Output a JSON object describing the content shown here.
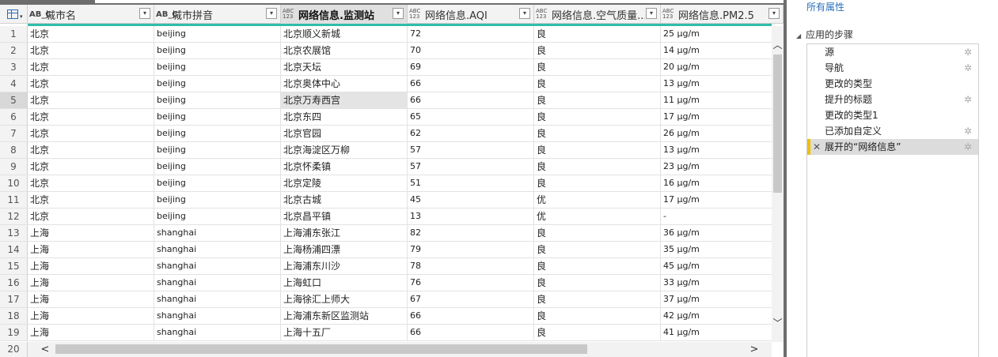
{
  "columns": [
    {
      "type": "AB_C",
      "name": "城市名"
    },
    {
      "type": "AB_C",
      "name": "城市拼音"
    },
    {
      "type_top": "ABC",
      "type_bottom": "123",
      "name": "网络信息.监测站"
    },
    {
      "type_top": "ABC",
      "type_bottom": "123",
      "name": "网络信息.AQI"
    },
    {
      "type_top": "ABC",
      "type_bottom": "123",
      "name": "网络信息.空气质量..."
    },
    {
      "type_top": "ABC",
      "type_bottom": "123",
      "name": "网络信息.PM2.5"
    }
  ],
  "rows": [
    {
      "n": "1",
      "c": [
        "北京",
        "beijing",
        "北京顺义新城",
        "72",
        "良",
        "25 μg/m"
      ]
    },
    {
      "n": "2",
      "c": [
        "北京",
        "beijing",
        "北京农展馆",
        "70",
        "良",
        "14 μg/m"
      ]
    },
    {
      "n": "3",
      "c": [
        "北京",
        "beijing",
        "北京天坛",
        "69",
        "良",
        "20 μg/m"
      ]
    },
    {
      "n": "4",
      "c": [
        "北京",
        "beijing",
        "北京奥体中心",
        "66",
        "良",
        "13 μg/m"
      ]
    },
    {
      "n": "5",
      "c": [
        "北京",
        "beijing",
        "北京万寿西宫",
        "66",
        "良",
        "11 μg/m"
      ]
    },
    {
      "n": "6",
      "c": [
        "北京",
        "beijing",
        "北京东四",
        "65",
        "良",
        "17 μg/m"
      ]
    },
    {
      "n": "7",
      "c": [
        "北京",
        "beijing",
        "北京官园",
        "62",
        "良",
        "26 μg/m"
      ]
    },
    {
      "n": "8",
      "c": [
        "北京",
        "beijing",
        "北京海淀区万柳",
        "57",
        "良",
        "13 μg/m"
      ]
    },
    {
      "n": "9",
      "c": [
        "北京",
        "beijing",
        "北京怀柔镇",
        "57",
        "良",
        "23 μg/m"
      ]
    },
    {
      "n": "10",
      "c": [
        "北京",
        "beijing",
        "北京定陵",
        "51",
        "良",
        "16 μg/m"
      ]
    },
    {
      "n": "11",
      "c": [
        "北京",
        "beijing",
        "北京古城",
        "45",
        "优",
        "17 μg/m"
      ]
    },
    {
      "n": "12",
      "c": [
        "北京",
        "beijing",
        "北京昌平镇",
        "13",
        "优",
        "-"
      ]
    },
    {
      "n": "13",
      "c": [
        "上海",
        "shanghai",
        "上海浦东张江",
        "82",
        "良",
        "36 μg/m"
      ]
    },
    {
      "n": "14",
      "c": [
        "上海",
        "shanghai",
        "上海杨浦四漂",
        "79",
        "良",
        "35 μg/m"
      ]
    },
    {
      "n": "15",
      "c": [
        "上海",
        "shanghai",
        "上海浦东川沙",
        "78",
        "良",
        "45 μg/m"
      ]
    },
    {
      "n": "16",
      "c": [
        "上海",
        "shanghai",
        "上海虹口",
        "76",
        "良",
        "33 μg/m"
      ]
    },
    {
      "n": "17",
      "c": [
        "上海",
        "shanghai",
        "上海徐汇上师大",
        "67",
        "良",
        "37 μg/m"
      ]
    },
    {
      "n": "18",
      "c": [
        "上海",
        "shanghai",
        "上海浦东新区监测站",
        "66",
        "良",
        "42 μg/m"
      ]
    },
    {
      "n": "19",
      "c": [
        "上海",
        "shanghai",
        "上海十五厂",
        "66",
        "良",
        "41 μg/m"
      ]
    }
  ],
  "last_row_number": "20",
  "selected_row": "5",
  "selected_column": "网络信息.监测站",
  "icons": {
    "table": "table-icon",
    "dropdown": "▾",
    "scroll_up": "︿",
    "scroll_down": "﹀",
    "scroll_left": "<",
    "scroll_right": ">",
    "gear": "✲",
    "delete": "✕"
  },
  "right_pane": {
    "all_properties": "所有属性",
    "steps_title": "应用的步骤",
    "steps": [
      {
        "label": "源",
        "has_gear": true
      },
      {
        "label": "导航",
        "has_gear": true
      },
      {
        "label": "更改的类型",
        "has_gear": false
      },
      {
        "label": "提升的标题",
        "has_gear": true
      },
      {
        "label": "更改的类型1",
        "has_gear": false
      },
      {
        "label": "已添加自定义",
        "has_gear": true
      },
      {
        "label": "展开的“网络信息”",
        "has_gear": true,
        "active": true
      }
    ]
  },
  "colors": {
    "accent_teal": "#2ebdaa",
    "link_blue": "#2a6ebb",
    "active_step_marker": "#f0c000"
  }
}
